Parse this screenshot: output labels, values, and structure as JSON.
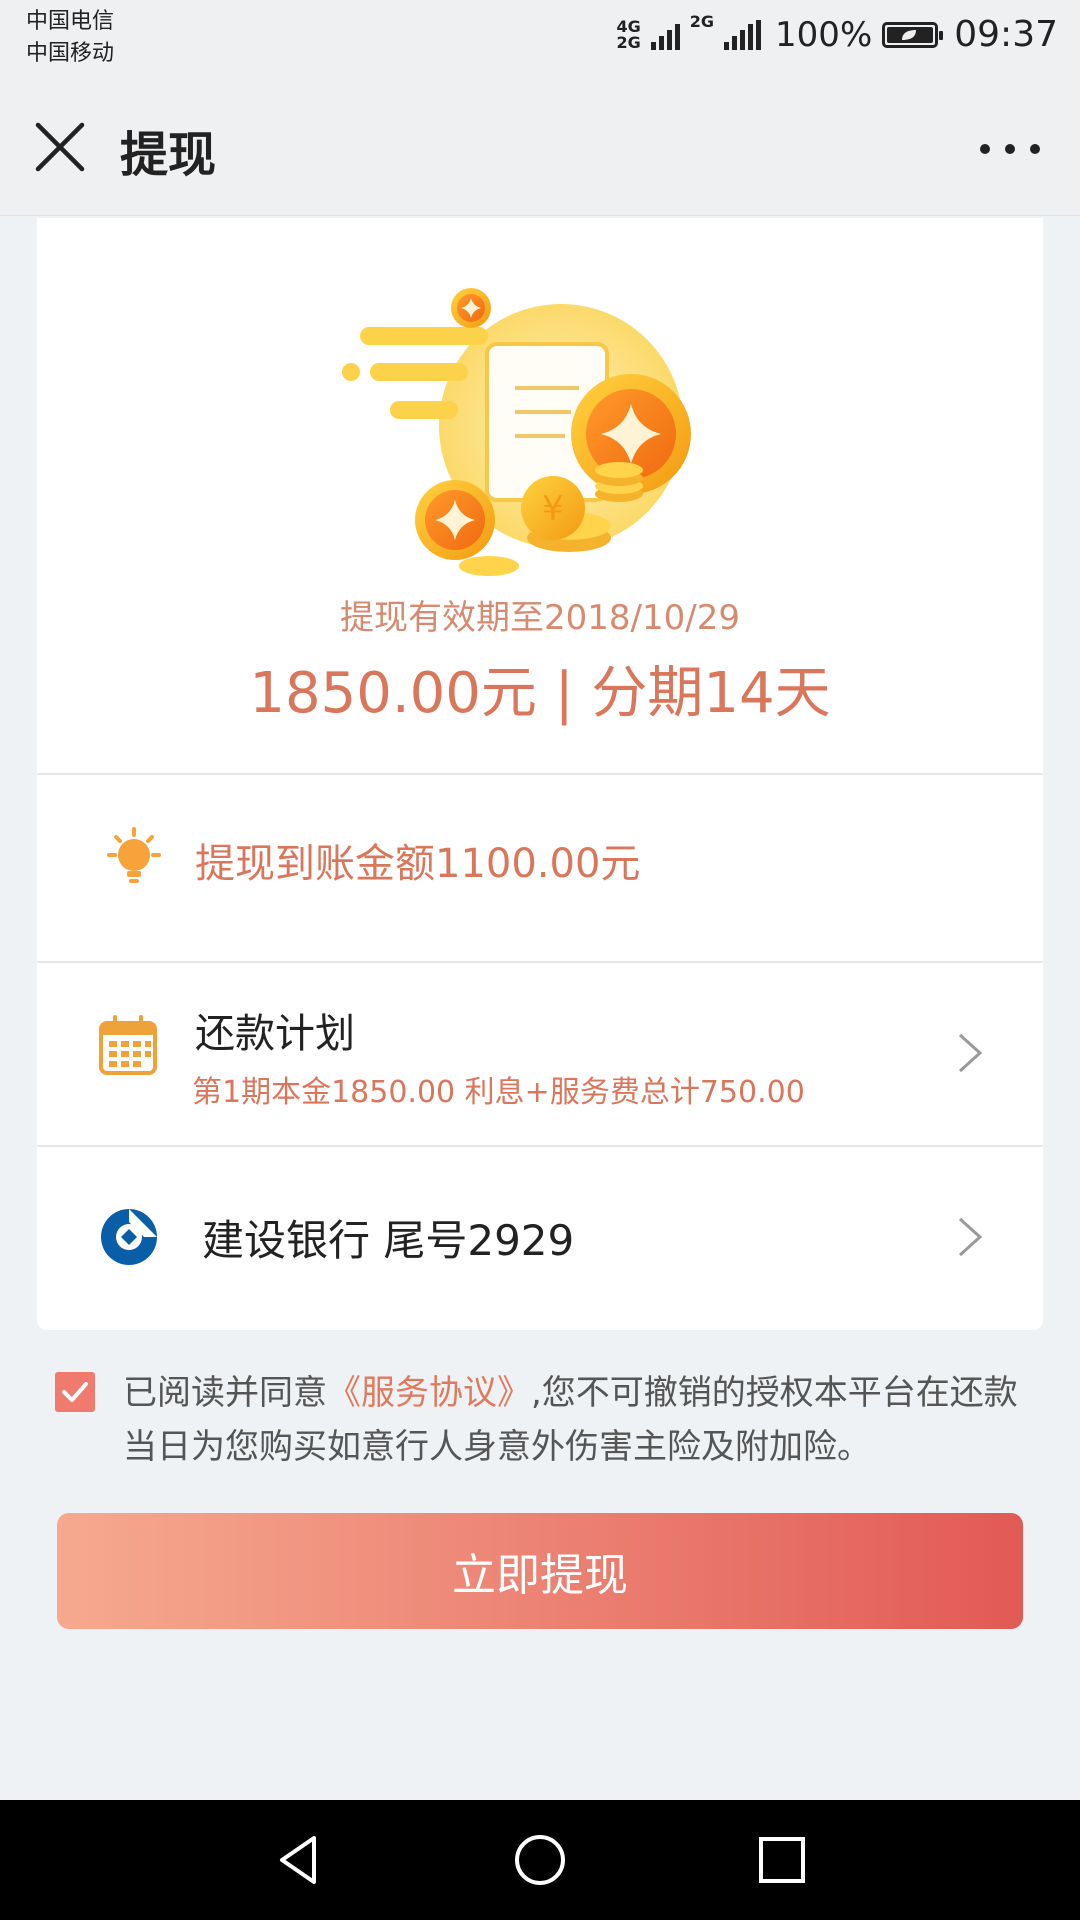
{
  "status_bar": {
    "carrier_1": "中国电信",
    "carrier_2": "中国移动",
    "net_1_top": "4G",
    "net_1_bottom": "2G",
    "net_2": "2G",
    "battery": "100%",
    "time": "09:37"
  },
  "navbar": {
    "title": "提现",
    "close_icon": "close-icon",
    "more_icon": "more-icon"
  },
  "hero": {
    "valid_until": "提现有效期至2018/10/29",
    "amount_term": "1850.00元 | 分期14天",
    "illustration_icon": "coins-document-icon"
  },
  "credit_row": {
    "icon": "lightbulb-icon",
    "text": "提现到账金额1100.00元"
  },
  "plan_row": {
    "icon": "calendar-icon",
    "title": "还款计划",
    "detail": "第1期本金1850.00 利息+服务费总计750.00"
  },
  "bank_row": {
    "icon": "ccb-bank-logo",
    "text": "建设银行 尾号2929"
  },
  "agreement": {
    "checked": true,
    "prefix": "已阅读并同意",
    "link": "《服务协议》",
    "suffix": ",您不可撤销的授权本平台在还款当日为您购买如意行人身意外伤害主险及附加险。"
  },
  "submit_label": "立即提现",
  "colors": {
    "accent": "#d9765c",
    "button_start": "#f6a98f",
    "button_end": "#e25a55",
    "checkbox": "#ef7a6d",
    "bank_blue": "#0a5ea8"
  }
}
